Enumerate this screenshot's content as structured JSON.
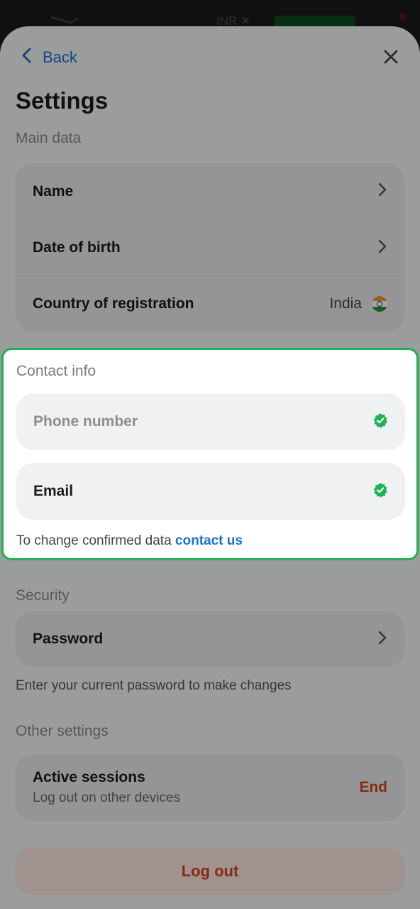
{
  "background": {
    "currency": "INR"
  },
  "header": {
    "back_label": "Back",
    "title": "Settings"
  },
  "main_data": {
    "section_label": "Main data",
    "rows": [
      {
        "label": "Name"
      },
      {
        "label": "Date of birth"
      },
      {
        "label": "Country of registration",
        "value": "India"
      }
    ]
  },
  "contact_info": {
    "section_label": "Contact info",
    "phone_label": "Phone number",
    "email_label": "Email",
    "note_prefix": "To change confirmed data",
    "note_link": "contact us"
  },
  "security": {
    "section_label": "Security",
    "password_label": "Password",
    "helper": "Enter your current password to make changes"
  },
  "other_settings": {
    "section_label": "Other settings",
    "active_sessions_label": "Active sessions",
    "active_sessions_sub": "Log out on other devices",
    "end_label": "End"
  },
  "logout_label": "Log out",
  "colors": {
    "accent_blue": "#1a73c9",
    "verified_green": "#1fb153",
    "danger_orange": "#d6431e"
  }
}
